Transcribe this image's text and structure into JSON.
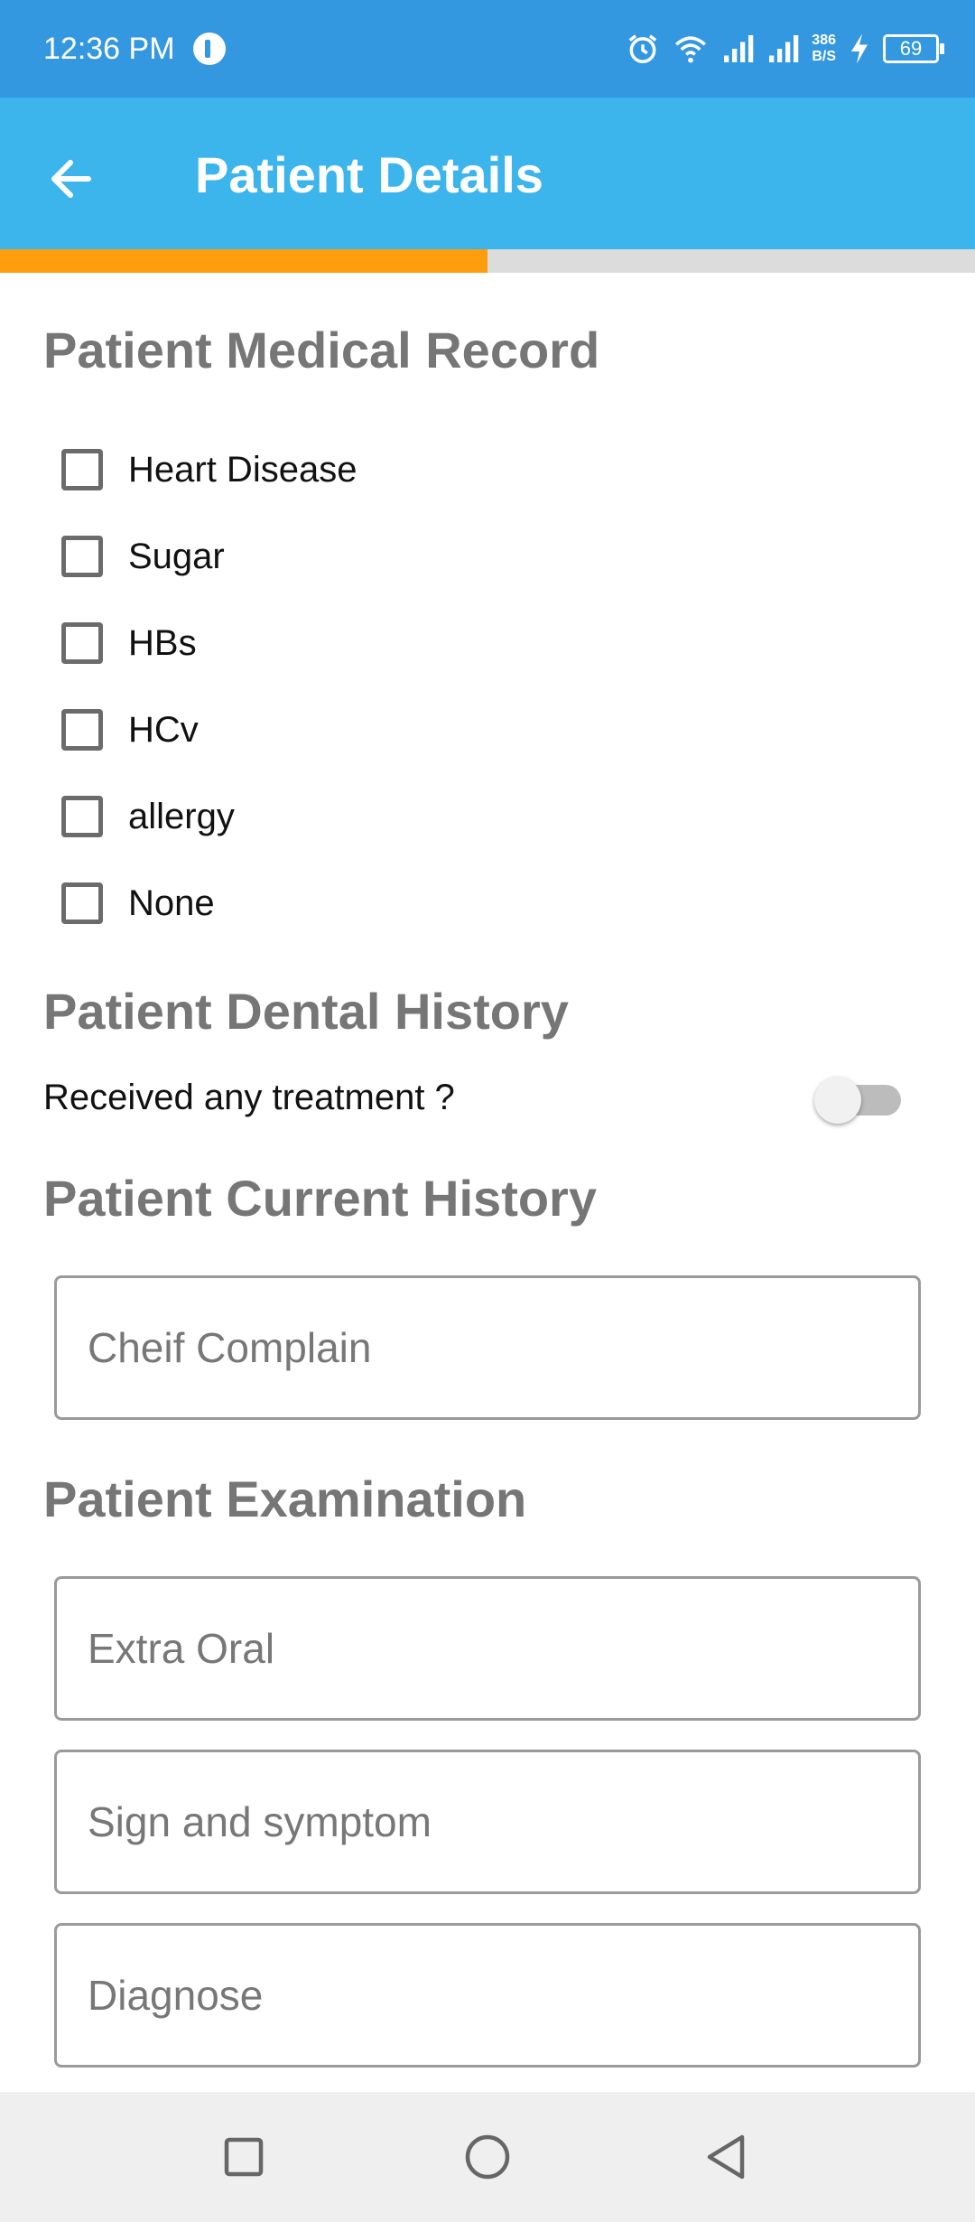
{
  "status_bar": {
    "time": "12:36 PM",
    "net_speed_value": "386",
    "net_speed_unit": "B/S",
    "battery": "69",
    "icons": [
      "notification-app-icon",
      "alarm-icon",
      "wifi-icon",
      "signal-icon",
      "signal-icon",
      "charging-icon",
      "battery-icon"
    ]
  },
  "app_bar": {
    "title": "Patient Details",
    "back_icon": "arrow-left-icon"
  },
  "progress": {
    "fraction": 0.5,
    "fill_color": "#ff9d0c",
    "track_color": "#dcdcdc"
  },
  "medical_record": {
    "heading": "Patient Medical Record",
    "conditions": [
      {
        "label": "Heart Disease",
        "checked": false
      },
      {
        "label": "Sugar",
        "checked": false
      },
      {
        "label": "HBs",
        "checked": false
      },
      {
        "label": "HCv",
        "checked": false
      },
      {
        "label": "allergy",
        "checked": false
      },
      {
        "label": "None",
        "checked": false
      }
    ]
  },
  "dental_history": {
    "heading": "Patient Dental History",
    "treatment_label": "Received any treatment ?",
    "treatment_on": false
  },
  "current_history": {
    "heading": "Patient Current History",
    "chief_complain": {
      "placeholder": "Cheif Complain",
      "value": ""
    }
  },
  "examination": {
    "heading": "Patient Examination",
    "extra_oral": {
      "placeholder": "Extra Oral",
      "value": ""
    },
    "sign_symptom": {
      "placeholder": "Sign and symptom",
      "value": ""
    },
    "diagnose": {
      "placeholder": "Diagnose",
      "value": ""
    }
  },
  "nav_bar": {
    "icons": [
      "recents-square-icon",
      "home-circle-icon",
      "back-triangle-icon"
    ]
  },
  "colors": {
    "status_bar": "#3498e0",
    "app_bar": "#3cb4ec",
    "heading": "#767676"
  }
}
